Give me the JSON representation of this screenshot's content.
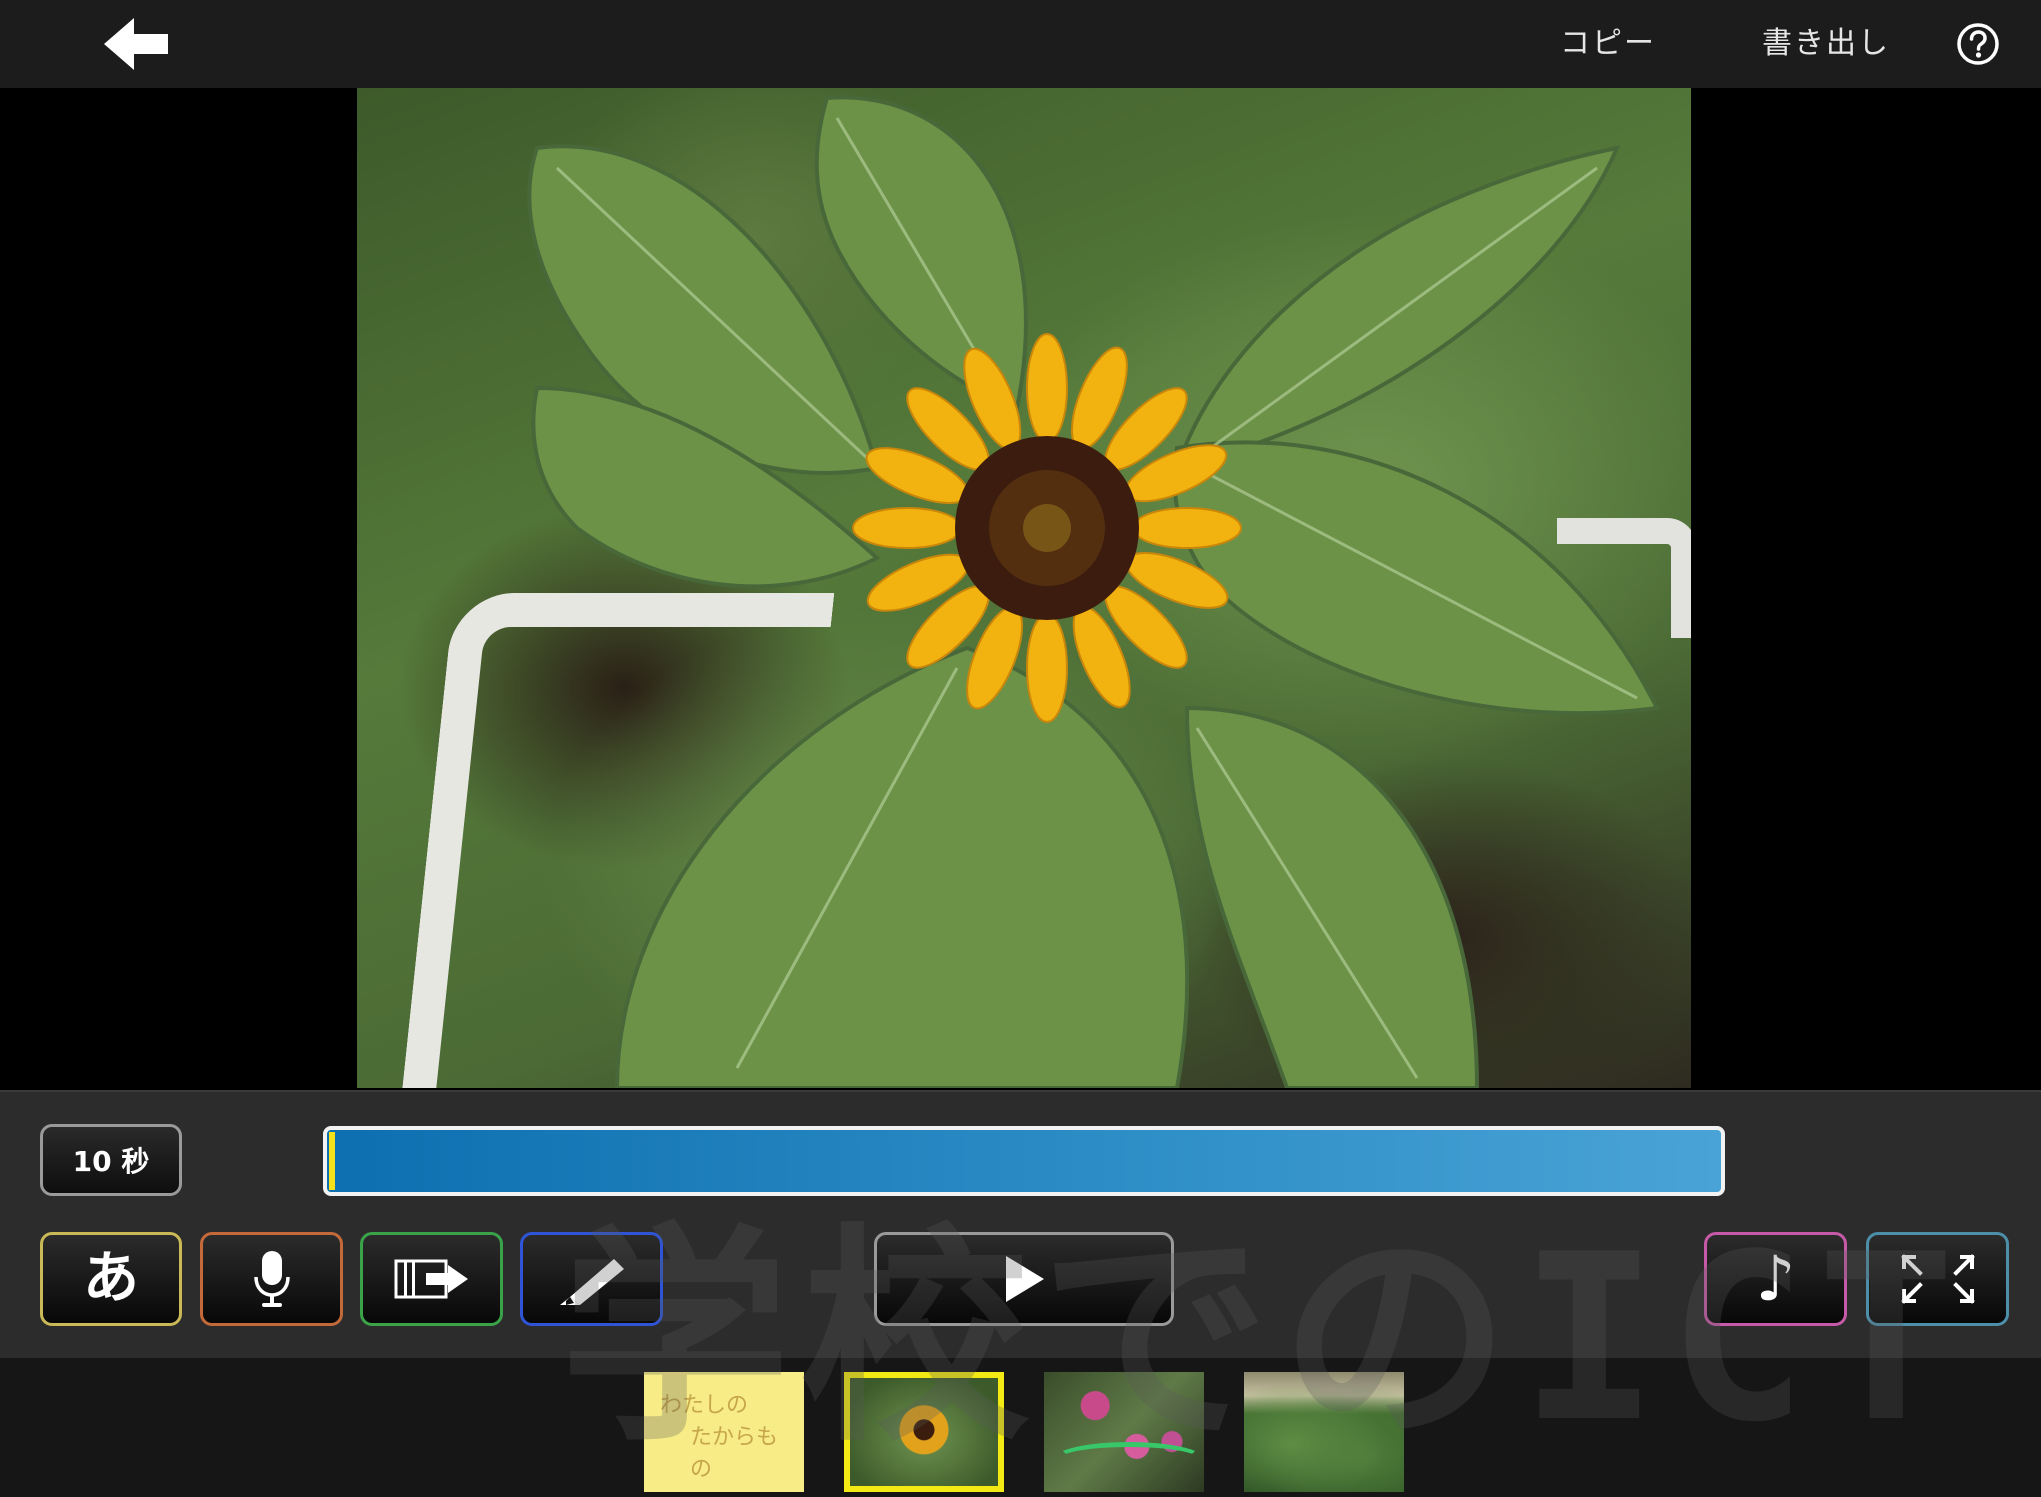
{
  "topbar": {
    "copy_label": "コピー",
    "export_label": "書き出し"
  },
  "icons": {
    "back": "arrow-left-icon",
    "help": "question-circle-icon",
    "text": "hiragana-a-icon",
    "mic": "microphone-icon",
    "transition": "transition-arrow-icon",
    "draw": "pencil-icon",
    "play": "play-icon",
    "music": "music-note-icon",
    "fullscreen": "expand-arrows-icon"
  },
  "controls": {
    "duration_label": "10 秒",
    "text_button_glyph": "あ",
    "music_button_glyph": "♪",
    "playback_progress": 0.0
  },
  "colors": {
    "timeline_fill": "#1a7fbf",
    "playhead": "#f3e21a",
    "text_button_border": "#c9b957",
    "mic_button_border": "#c46a3a",
    "transition_button_border": "#3aa34a",
    "draw_button_border": "#2f55d6",
    "music_button_border": "#c65aa8",
    "fullscreen_button_border": "#4d8fa8",
    "selected_thumbnail_border": "#f3ea14"
  },
  "filmstrip": {
    "thumbnails": [
      {
        "kind": "note",
        "line1": "わたしの",
        "line2": "たからもの",
        "selected": false
      },
      {
        "kind": "photo-sunflower",
        "selected": true
      },
      {
        "kind": "photo-morning-glory",
        "selected": false
      },
      {
        "kind": "photo-field",
        "selected": false
      }
    ]
  },
  "watermark": {
    "text": "学校でのICT"
  }
}
